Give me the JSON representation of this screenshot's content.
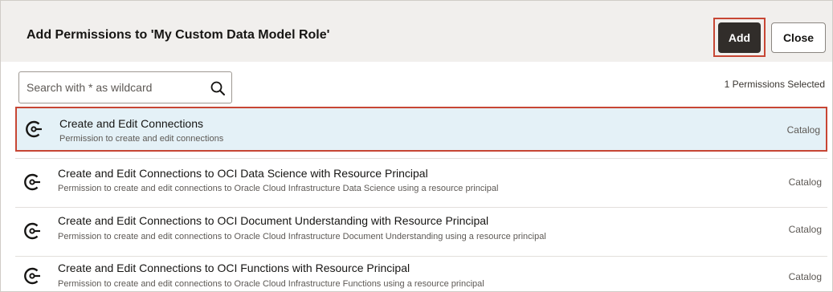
{
  "dialog": {
    "title": "Add Permissions to 'My Custom Data Model Role'",
    "add_label": "Add",
    "close_label": "Close"
  },
  "search": {
    "placeholder": "Search with * as wildcard",
    "value": "",
    "icon": "search-icon"
  },
  "selection": {
    "count_text": "1 Permissions Selected"
  },
  "permissions": [
    {
      "title": "Create and Edit Connections",
      "description": "Permission to create and edit connections",
      "category": "Catalog",
      "icon": "connection-icon",
      "selected": true
    },
    {
      "title": "Create and Edit Connections to OCI Data Science with Resource Principal",
      "description": "Permission to create and edit connections to Oracle Cloud Infrastructure Data Science using a resource principal",
      "category": "Catalog",
      "icon": "connection-icon",
      "selected": false
    },
    {
      "title": "Create and Edit Connections to OCI Document Understanding with Resource Principal",
      "description": "Permission to create and edit connections to Oracle Cloud Infrastructure Document Understanding using a resource principal",
      "category": "Catalog",
      "icon": "connection-icon",
      "selected": false
    },
    {
      "title": "Create and Edit Connections to OCI Functions with Resource Principal",
      "description": "Permission to create and edit connections to Oracle Cloud Infrastructure Functions using a resource principal",
      "category": "Catalog",
      "icon": "connection-icon",
      "selected": false
    }
  ],
  "colors": {
    "header_bg": "#f1efed",
    "primary_button": "#312d2a",
    "highlight_border": "#c74634",
    "selected_row_bg": "#e4f1f7"
  }
}
